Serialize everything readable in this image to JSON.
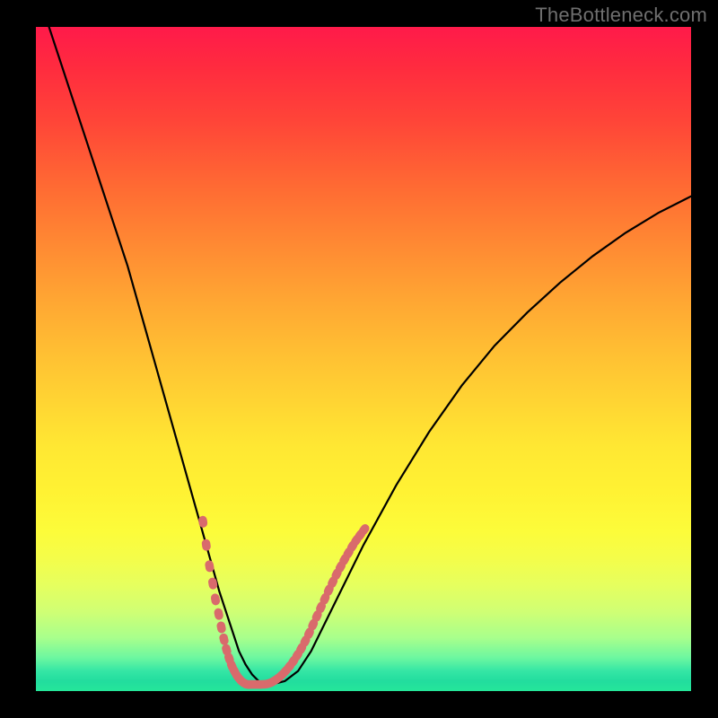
{
  "watermark": "TheBottleneck.com",
  "colors": {
    "page_background": "#000000",
    "watermark_text": "#6f6f6f",
    "curve_stroke": "#000000",
    "marker_fill": "#d96a6c",
    "gradient_top": "#ff1a4a",
    "gradient_bottom": "#25e69a"
  },
  "chart_data": {
    "type": "line",
    "title": "",
    "xlabel": "",
    "ylabel": "",
    "xlim": [
      0,
      100
    ],
    "ylim": [
      0,
      100
    ],
    "grid": false,
    "legend": false,
    "annotations": [],
    "series": [
      {
        "name": "curve",
        "x": [
          2,
          4,
          6,
          8,
          10,
          12,
          14,
          16,
          18,
          20,
          22,
          24,
          26,
          28,
          29,
          30,
          31,
          32,
          33,
          34,
          35,
          36,
          38,
          40,
          42,
          44,
          46,
          50,
          55,
          60,
          65,
          70,
          75,
          80,
          85,
          90,
          95,
          100
        ],
        "y": [
          100,
          94,
          88,
          82,
          76,
          70,
          64,
          57,
          50,
          43,
          36,
          29,
          22,
          15,
          12,
          9,
          6,
          4,
          2.5,
          1.5,
          1,
          1,
          1.5,
          3,
          6,
          10,
          14,
          22,
          31,
          39,
          46,
          52,
          57,
          61.5,
          65.5,
          69,
          72,
          74.5
        ]
      }
    ],
    "markers": [
      {
        "name": "left-cluster",
        "style": "thick-dotted",
        "x": [
          25.5,
          26.0,
          26.5,
          27.0,
          27.4,
          27.9,
          28.3,
          28.7,
          29.1,
          29.5,
          29.9,
          30.3,
          30.7,
          31.1,
          31.5,
          31.9,
          32.3,
          32.7,
          33.1,
          33.5,
          33.9
        ],
        "y": [
          25.5,
          22.0,
          18.8,
          16.2,
          13.8,
          11.6,
          9.6,
          7.8,
          6.2,
          4.9,
          3.8,
          3.0,
          2.3,
          1.8,
          1.4,
          1.15,
          1.0,
          1.0,
          1.0,
          1.0,
          1.0
        ]
      },
      {
        "name": "right-cluster",
        "style": "thick-dotted",
        "x": [
          34.5,
          35.1,
          35.7,
          36.3,
          36.9,
          37.5,
          38.1,
          38.7,
          39.3,
          39.9,
          40.5,
          41.1,
          41.7,
          42.3,
          42.9,
          43.5,
          44.1,
          44.7,
          45.3,
          45.9,
          46.5,
          47.1,
          47.7,
          48.3,
          48.9,
          49.5,
          50.1
        ],
        "y": [
          1.0,
          1.05,
          1.2,
          1.5,
          1.9,
          2.4,
          3.0,
          3.7,
          4.5,
          5.4,
          6.4,
          7.5,
          8.7,
          10.0,
          11.3,
          12.6,
          13.9,
          15.2,
          16.4,
          17.6,
          18.7,
          19.8,
          20.8,
          21.8,
          22.7,
          23.5,
          24.3
        ]
      }
    ]
  }
}
